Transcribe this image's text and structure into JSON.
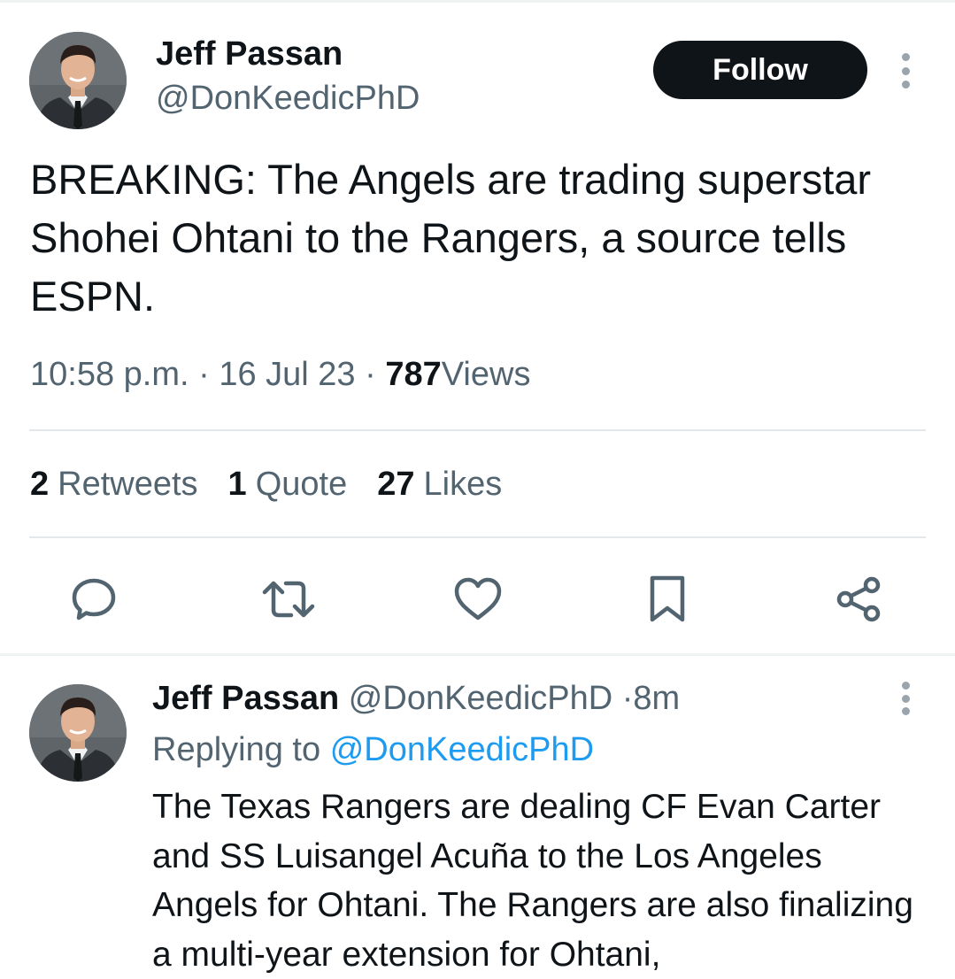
{
  "tweet": {
    "author_name": "Jeff Passan",
    "author_handle": "@DonKeedicPhD",
    "follow_label": "Follow",
    "text": "BREAKING: The Angels are trading superstar Shohei Ohtani to the Rangers, a source tells ESPN.",
    "time": "10:58 p.m.",
    "separator": "·",
    "date": "16 Jul 23",
    "views_count": "787",
    "views_label": "Views",
    "stats": {
      "retweets_count": "2",
      "retweets_label": "Retweets",
      "quotes_count": "1",
      "quotes_label": "Quote",
      "likes_count": "27",
      "likes_label": "Likes"
    },
    "actions": [
      "reply-icon",
      "retweet-icon",
      "like-icon",
      "bookmark-icon",
      "share-icon"
    ]
  },
  "reply": {
    "author_name": "Jeff Passan",
    "author_handle": "@DonKeedicPhD",
    "separator": "·",
    "time_ago": "8m",
    "replying_prefix": "Replying to",
    "replying_handle": "@DonKeedicPhD",
    "text": "The Texas Rangers are dealing CF Evan Carter and SS Luisangel Acuña to the Los Angeles Angels for Ohtani. The Rangers are also finalizing a multi-year extension for Ohtani,"
  },
  "colors": {
    "text_primary": "#0f1419",
    "text_secondary": "#536471",
    "link": "#1d9bf0",
    "follow_button_bg": "#0f1419",
    "divider": "#e4e8eb"
  }
}
